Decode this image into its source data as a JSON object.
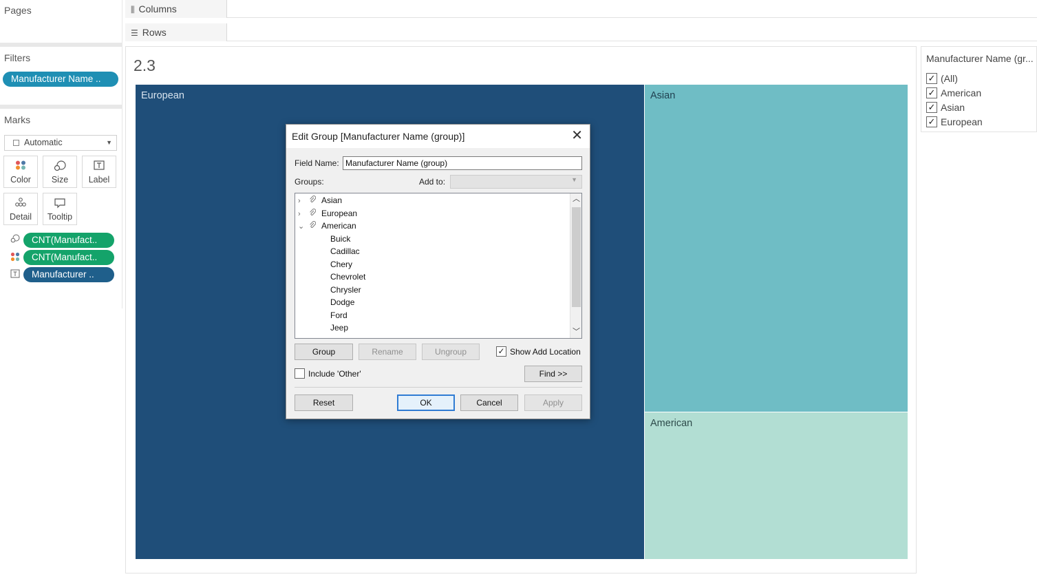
{
  "left": {
    "pages_title": "Pages",
    "filters_title": "Filters",
    "filter_pill": "Manufacturer Name ..",
    "marks_title": "Marks",
    "mark_type": "Automatic",
    "mark_cards": [
      {
        "label": "Color",
        "icon": "color-dots-icon"
      },
      {
        "label": "Size",
        "icon": "size-icon"
      },
      {
        "label": "Label",
        "icon": "label-icon"
      },
      {
        "label": "Detail",
        "icon": "detail-icon"
      },
      {
        "label": "Tooltip",
        "icon": "tooltip-icon"
      }
    ],
    "mark_pills": [
      {
        "label": "CNT(Manufact..",
        "icon": "size-icon"
      },
      {
        "label": "CNT(Manufact..",
        "icon": "color-dots-icon"
      },
      {
        "label": "Manufacturer ..",
        "icon": "label-icon"
      }
    ]
  },
  "shelves": {
    "columns": "Columns",
    "rows": "Rows"
  },
  "viz": {
    "title": "2.3",
    "tiles": [
      {
        "label": "European",
        "color": "#1f4e79",
        "text_color": "#d7e3ee"
      },
      {
        "label": "Asian",
        "color": "#6fbdc5",
        "text_color": "#1f3f4f"
      },
      {
        "label": "American",
        "color": "#b2ded3",
        "text_color": "#2d4a4a"
      }
    ]
  },
  "legend": {
    "title": "Manufacturer Name (gr...",
    "items": [
      {
        "label": "(All)",
        "checked": true
      },
      {
        "label": "American",
        "checked": true
      },
      {
        "label": "Asian",
        "checked": true
      },
      {
        "label": "European",
        "checked": true
      }
    ]
  },
  "dialog": {
    "title": "Edit Group [Manufacturer Name (group)]",
    "close": "✕",
    "field_name_label": "Field Name:",
    "field_name_value": "Manufacturer Name (group)",
    "groups_label": "Groups:",
    "add_to_label": "Add to:",
    "tree": [
      {
        "label": "Asian",
        "level": 0,
        "expander": "›",
        "is_group": true
      },
      {
        "label": "European",
        "level": 0,
        "expander": "›",
        "is_group": true
      },
      {
        "label": "American",
        "level": 0,
        "expander": "⌄",
        "is_group": true
      },
      {
        "label": "Buick",
        "level": 1
      },
      {
        "label": "Cadillac",
        "level": 1
      },
      {
        "label": "Chery",
        "level": 1
      },
      {
        "label": "Chevrolet",
        "level": 1
      },
      {
        "label": "Chrysler",
        "level": 1
      },
      {
        "label": "Dodge",
        "level": 1
      },
      {
        "label": "Ford",
        "level": 1
      },
      {
        "label": "Jeep",
        "level": 1
      }
    ],
    "buttons": {
      "group": "Group",
      "rename": "Rename",
      "ungroup": "Ungroup",
      "find": "Find >>",
      "reset": "Reset",
      "ok": "OK",
      "cancel": "Cancel",
      "apply": "Apply"
    },
    "show_add_location": {
      "label": "Show Add Location",
      "checked": true
    },
    "include_other": {
      "label": "Include 'Other'",
      "checked": false
    }
  }
}
